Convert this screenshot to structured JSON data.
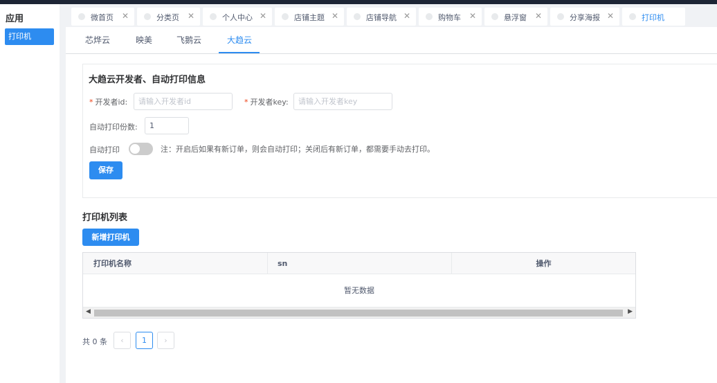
{
  "sidebar": {
    "title": "应用",
    "items": [
      {
        "label": "打印机",
        "active": true
      }
    ]
  },
  "tabs": [
    {
      "label": "微首页",
      "active": false
    },
    {
      "label": "分类页",
      "active": false
    },
    {
      "label": "个人中心",
      "active": false
    },
    {
      "label": "店铺主题",
      "active": false
    },
    {
      "label": "店铺导航",
      "active": false
    },
    {
      "label": "购物车",
      "active": false
    },
    {
      "label": "悬浮窗",
      "active": false
    },
    {
      "label": "分享海报",
      "active": false
    },
    {
      "label": "打印机",
      "active": true
    }
  ],
  "subtabs": [
    {
      "label": "芯烨云",
      "active": false
    },
    {
      "label": "映美",
      "active": false
    },
    {
      "label": "飞鹅云",
      "active": false
    },
    {
      "label": "大趋云",
      "active": true
    }
  ],
  "settings": {
    "title": "大趋云开发者、自动打印信息",
    "required_mark": "*",
    "dev_id_label": "开发者id:",
    "dev_id_placeholder": "请输入开发者id",
    "dev_key_label": "开发者key:",
    "dev_key_placeholder": "请输入开发者key",
    "copies_label": "自动打印份数:",
    "copies_value": "1",
    "auto_print_label": "自动打印",
    "auto_print_on": false,
    "note": "注：开启后如果有新订单，则会自动打印；关闭后有新订单，都需要手动去打印。",
    "save_label": "保存"
  },
  "printers": {
    "title": "打印机列表",
    "add_label": "新增打印机",
    "columns": [
      "打印机名称",
      "sn",
      "操作"
    ],
    "rows": [],
    "empty_text": "暂无数据"
  },
  "pagination": {
    "total_text": "共 0 条",
    "current_page": "1"
  },
  "colors": {
    "accent": "#2d8cf0",
    "required": "#ed4014"
  }
}
